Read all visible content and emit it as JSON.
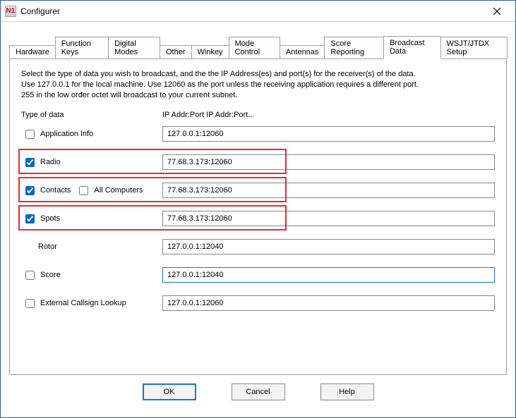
{
  "window": {
    "title": "Configurer",
    "icon_label": "N1"
  },
  "tabs": [
    "Hardware",
    "Function Keys",
    "Digital Modes",
    "Other",
    "Winkey",
    "Mode Control",
    "Antennas",
    "Score Reporting",
    "Broadcast Data",
    "WSJT/JTDX Setup"
  ],
  "active_tab_index": 8,
  "panel": {
    "description_line1": "Select the type of data you wish to broadcast, and the the IP Address(es) and port(s) for the receiver(s) of the data.",
    "description_line2": "Use 127.0.0.1 for the local machine.  Use 12060 as the port unless the receiving application requires a different port.",
    "description_line3": "255 in the low order octet will broadcast to your current subnet.",
    "col_type_label": "Type of data",
    "col_ip_label": "IP Addr:Port IP Addr:Port...",
    "rows": {
      "app_info": {
        "label": "Application Info",
        "checked": false,
        "value": "127.0.0.1:12060"
      },
      "radio": {
        "label": "Radio",
        "checked": true,
        "value": "77.68.3.173:12060"
      },
      "contacts": {
        "label": "Contacts",
        "checked": true,
        "all_label": "All Computers",
        "all_checked": false,
        "value": "77.68.3.173:12060"
      },
      "spots": {
        "label": "Spots",
        "checked": true,
        "value": "77.68.3.173:12060"
      },
      "rotor": {
        "label": "Rotor",
        "value": "127.0.0.1:12040"
      },
      "score": {
        "label": "Score",
        "checked": false,
        "value": "127.0.0.1:12040"
      },
      "ext_lookup": {
        "label": "External Callsign Lookup",
        "checked": false,
        "value": "127.0.0.1:12060"
      }
    }
  },
  "buttons": {
    "ok": "OK",
    "cancel": "Cancel",
    "help": "Help"
  }
}
